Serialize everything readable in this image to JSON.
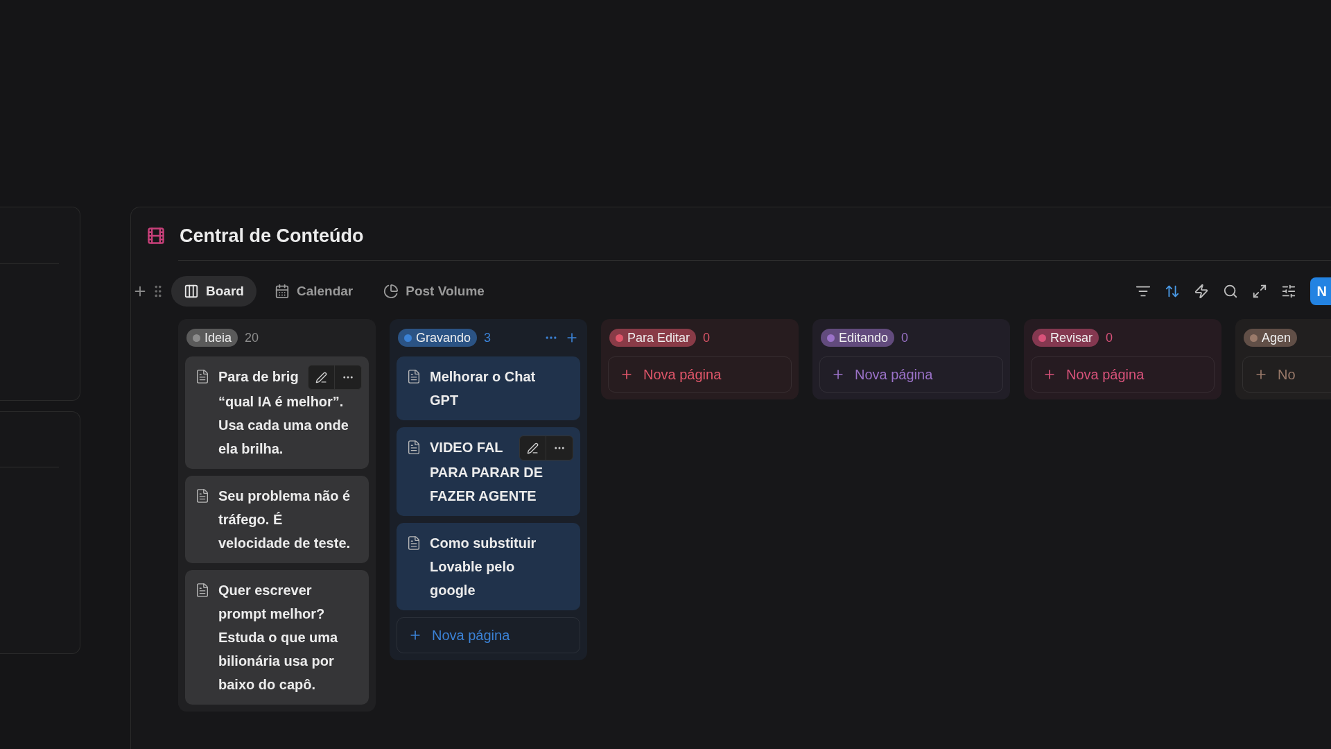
{
  "database": {
    "title": "Central de Conteúdo"
  },
  "views": [
    {
      "label": "Board",
      "kind": "board",
      "selected": true
    },
    {
      "label": "Calendar",
      "kind": "calendar",
      "selected": false
    },
    {
      "label": "Post Volume",
      "kind": "chart",
      "selected": false
    }
  ],
  "toolbar": {
    "new_button": "N"
  },
  "columns": [
    {
      "label": "Ideia",
      "count": "20",
      "color": "#8c8c8c",
      "header_actions": false,
      "cards": [
        {
          "title_start": "Para de brig",
          "title": "“qual IA é melhor”. Usa cada uma onde ela brilha.",
          "hovered": true
        },
        {
          "title": "Seu problema não é tráfego. É velocidade de teste.",
          "hovered": false
        },
        {
          "title": "Quer escrever prompt melhor? Estuda o que uma bilionária usa por baixo do capô.",
          "hovered": false
        }
      ]
    },
    {
      "label": "Gravando",
      "count": "3",
      "color": "#3b82d6",
      "header_actions": true,
      "cards": [
        {
          "title": "Melhorar o Chat GPT",
          "hovered": false
        },
        {
          "title_start": "VIDEO FAL",
          "title": "PARA PARAR DE FAZER AGENTE",
          "hovered": true
        },
        {
          "title": "Como substituir Lovable pelo google",
          "hovered": false
        }
      ],
      "add_label": "Nova página"
    },
    {
      "label": "Para Editar",
      "count": "0",
      "color": "#e0566a",
      "header_actions": false,
      "add_label": "Nova página"
    },
    {
      "label": "Editando",
      "count": "0",
      "color": "#9b72c8",
      "header_actions": false,
      "add_label": "Nova página"
    },
    {
      "label": "Revisar",
      "count": "0",
      "color": "#d8527a",
      "header_actions": false,
      "add_label": "Nova página"
    },
    {
      "label": "Agen",
      "color": "#9a7a6a",
      "add_label": "No"
    }
  ]
}
